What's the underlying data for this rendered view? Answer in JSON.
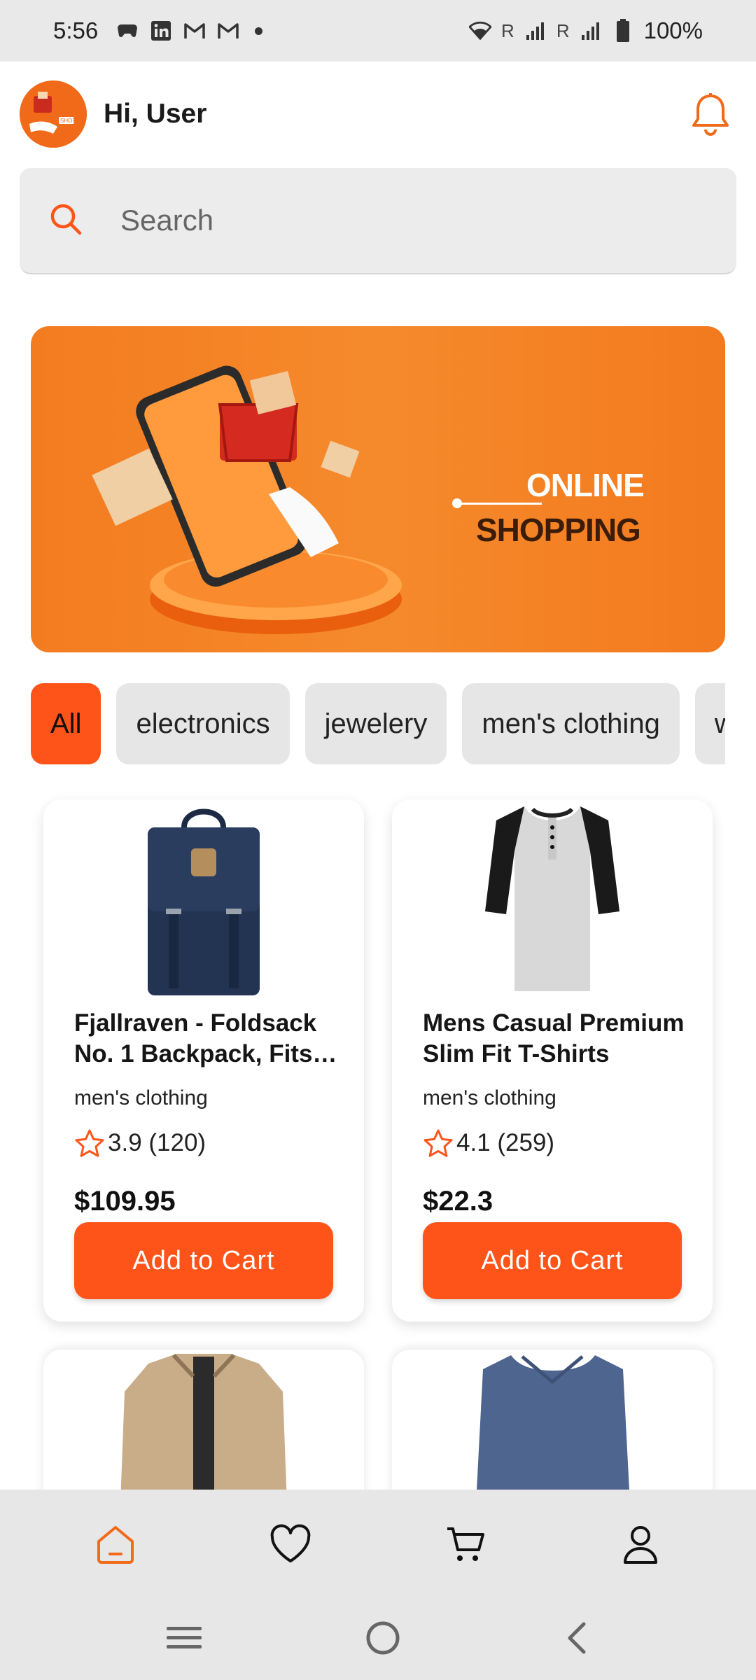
{
  "status_bar": {
    "time": "5:56",
    "signal_label_1": "R",
    "signal_label_2": "R",
    "battery": "100%",
    "icons": [
      "game-controller-icon",
      "linkedin-icon",
      "gmail-icon",
      "gmail-icon",
      "dot-icon",
      "wifi-icon",
      "signal-icon",
      "signal-icon",
      "battery-icon"
    ]
  },
  "header": {
    "greeting": "Hi, User",
    "bell_icon": "bell-icon",
    "accent_color": "#f06a1a"
  },
  "search": {
    "placeholder": "Search",
    "icon": "search-icon"
  },
  "banner": {
    "line1": "ONLINE",
    "line2": "SHOPPING"
  },
  "categories": {
    "items": [
      "All",
      "electronics",
      "jewelery",
      "men's clothing",
      "w"
    ],
    "selected": "All",
    "active_color": "#ff5419"
  },
  "products": [
    {
      "name": "Fjallraven - Foldsack No. 1 Backpack, Fits 1…",
      "category": "men's clothing",
      "rating": "3.9 (120)",
      "price": "$109.95",
      "button": "Add to Cart"
    },
    {
      "name": "Mens Casual Premium Slim Fit T-Shirts",
      "category": "men's clothing",
      "rating": "4.1 (259)",
      "price": "$22.3",
      "button": "Add to Cart"
    }
  ],
  "bottom_nav": {
    "items": [
      "home-icon",
      "heart-icon",
      "cart-icon",
      "profile-icon"
    ],
    "active": "home-icon"
  },
  "system_nav": {
    "items": [
      "menu-icon",
      "home-circle-icon",
      "back-icon"
    ]
  }
}
